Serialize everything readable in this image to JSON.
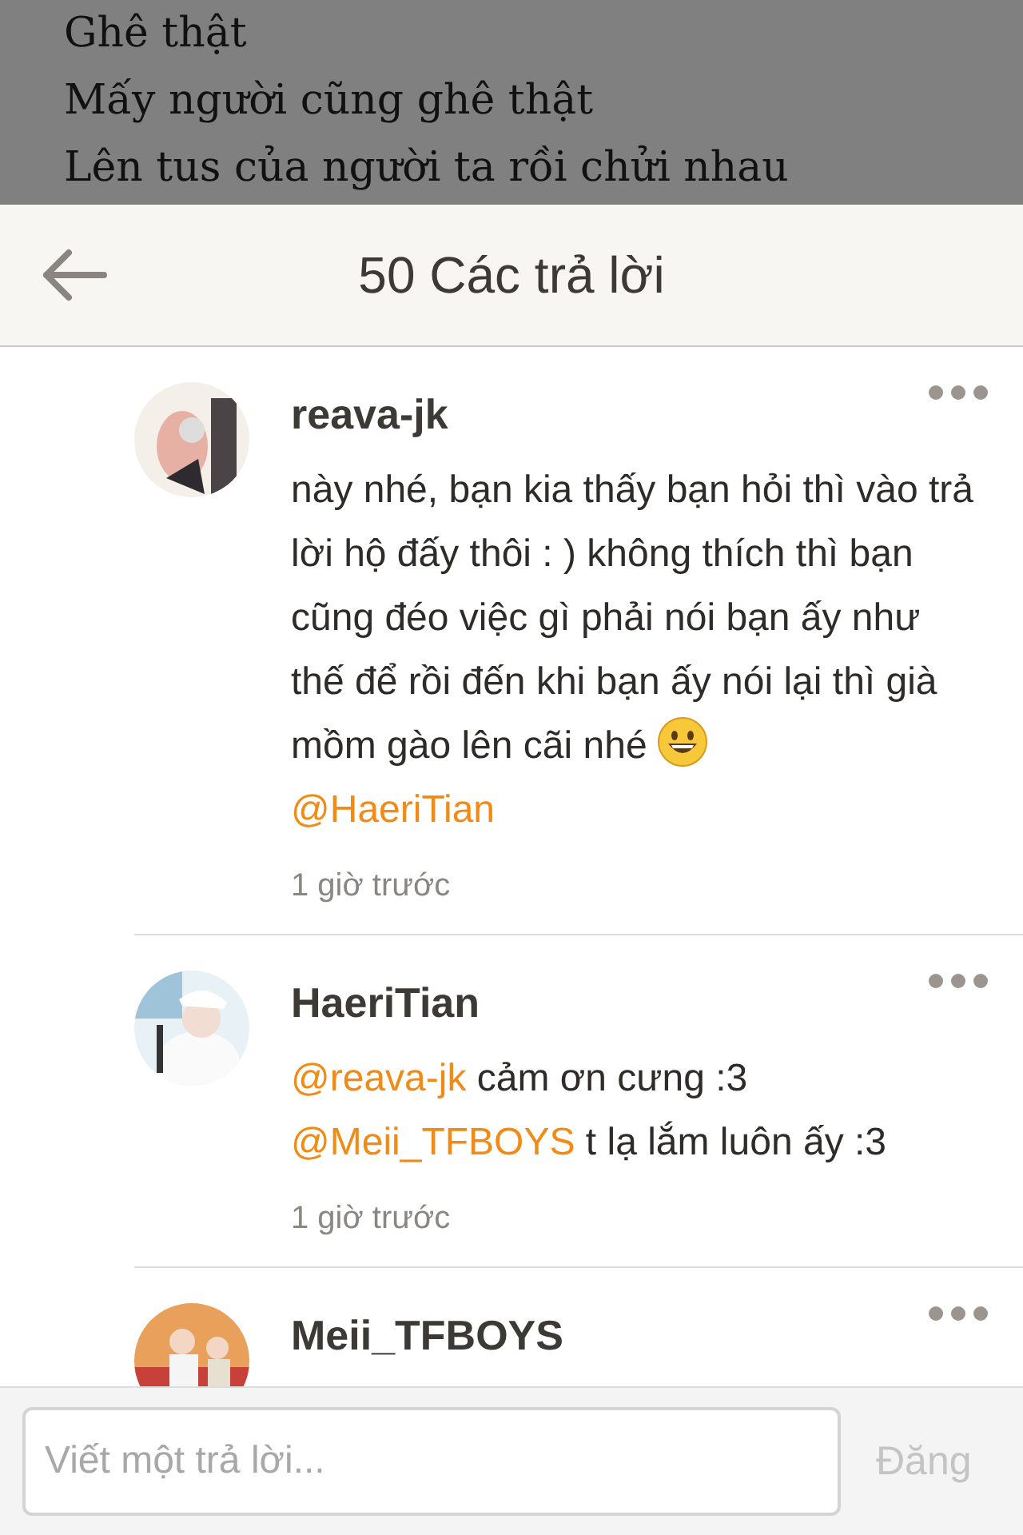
{
  "background_post": {
    "lines": [
      "Ghê thật",
      "Mấy người cũng ghê thật",
      "Lên tus của người ta rồi chửi nhau"
    ]
  },
  "header": {
    "title": "50 Các trả lời"
  },
  "replies": [
    {
      "author": "reava-jk",
      "avatar": {
        "kind": "picture"
      },
      "lines": [
        [
          {
            "kind": "text",
            "text": "này nhé, bạn kia thấy bạn hỏi thì vào trả lời hộ đấy thôi : ) không thích thì bạn cũng đéo việc gì phải nói bạn ấy như thế để rồi đến khi bạn ấy nói lại thì già mồm gào lên cãi nhé"
          },
          {
            "kind": "emoji"
          }
        ],
        [
          {
            "kind": "mention",
            "text": "@HaeriTian"
          }
        ]
      ],
      "time": "1 giờ trước"
    },
    {
      "author": "HaeriTian",
      "avatar": {
        "kind": "picture"
      },
      "lines": [
        [
          {
            "kind": "mention",
            "text": "@reava-jk"
          },
          {
            "kind": "text",
            "text": "cảm ơn cưng :3"
          }
        ],
        [
          {
            "kind": "mention",
            "text": "@Meii_TFBOYS"
          },
          {
            "kind": "text",
            "text": "t lạ lắm luôn ấy :3"
          }
        ]
      ],
      "time": "1 giờ trước"
    },
    {
      "author": "Meii_TFBOYS",
      "avatar": {
        "kind": "picture"
      }
    }
  ],
  "composer": {
    "placeholder": "Viết một trả lời...",
    "post_button": {
      "label": "Đăng",
      "disabled": true
    }
  }
}
